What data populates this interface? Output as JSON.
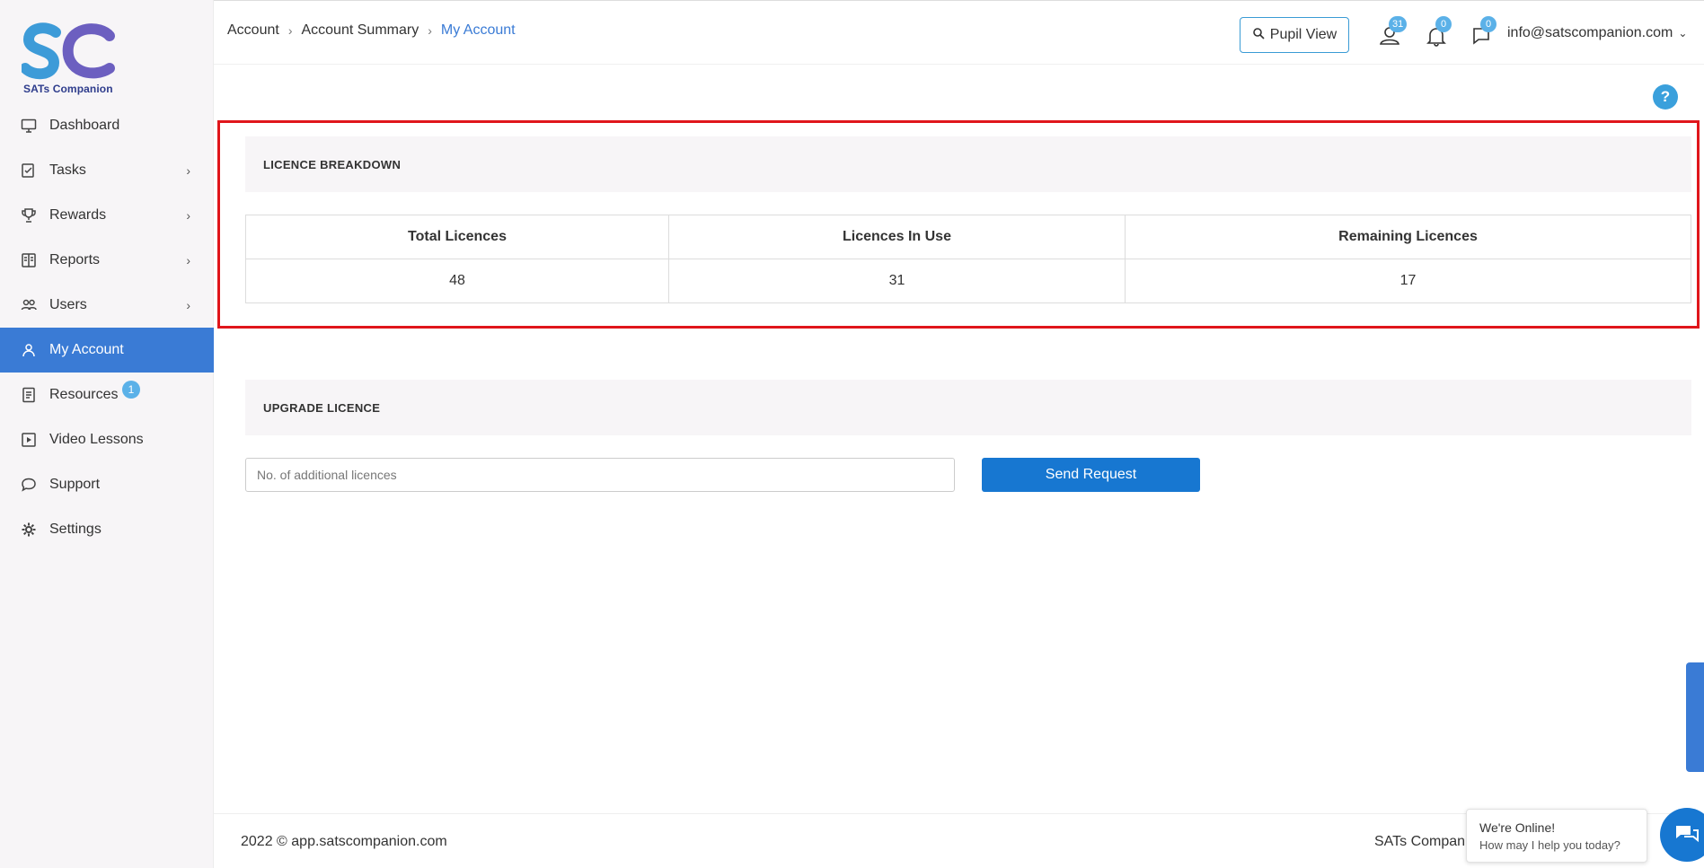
{
  "brand": {
    "name": "SATs Companion",
    "colors": {
      "accent": "#3a7bd5",
      "logo_blue": "#2e3c8c",
      "button": "#1777d1",
      "highlight": "#e0161b"
    }
  },
  "sidebar": {
    "items": [
      {
        "label": "Dashboard",
        "icon": "monitor-icon",
        "chevron": false,
        "active": false
      },
      {
        "label": "Tasks",
        "icon": "tasks-icon",
        "chevron": true,
        "active": false
      },
      {
        "label": "Rewards",
        "icon": "trophy-icon",
        "chevron": true,
        "active": false
      },
      {
        "label": "Reports",
        "icon": "reports-icon",
        "chevron": true,
        "active": false
      },
      {
        "label": "Users",
        "icon": "users-icon",
        "chevron": true,
        "active": false
      },
      {
        "label": "My Account",
        "icon": "account-icon",
        "chevron": false,
        "active": true
      },
      {
        "label": "Resources",
        "icon": "resources-icon",
        "chevron": false,
        "active": false,
        "badge": "1"
      },
      {
        "label": "Video Lessons",
        "icon": "video-icon",
        "chevron": false,
        "active": false
      },
      {
        "label": "Support",
        "icon": "support-icon",
        "chevron": false,
        "active": false
      },
      {
        "label": "Settings",
        "icon": "gear-icon",
        "chevron": false,
        "active": false
      }
    ]
  },
  "header": {
    "breadcrumb": [
      "Account",
      "Account Summary",
      "My Account"
    ],
    "pupil_view_label": "Pupil View",
    "badges": {
      "users": "31",
      "notifications": "0",
      "messages": "0"
    },
    "user_email": "info@satscompanion.com"
  },
  "licence_breakdown": {
    "title": "LICENCE BREAKDOWN",
    "columns": [
      "Total Licences",
      "Licences In Use",
      "Remaining Licences"
    ],
    "values": [
      "48",
      "31",
      "17"
    ]
  },
  "upgrade": {
    "title": "UPGRADE LICENCE",
    "input_placeholder": "No. of additional licences",
    "input_value": "",
    "button_label": "Send Request"
  },
  "help_label": "?",
  "footer": {
    "left": "2022 © app.satscompanion.com",
    "right": "SATs Compan"
  },
  "chat": {
    "title": "We're Online!",
    "subtitle": "How may I help you today?"
  }
}
